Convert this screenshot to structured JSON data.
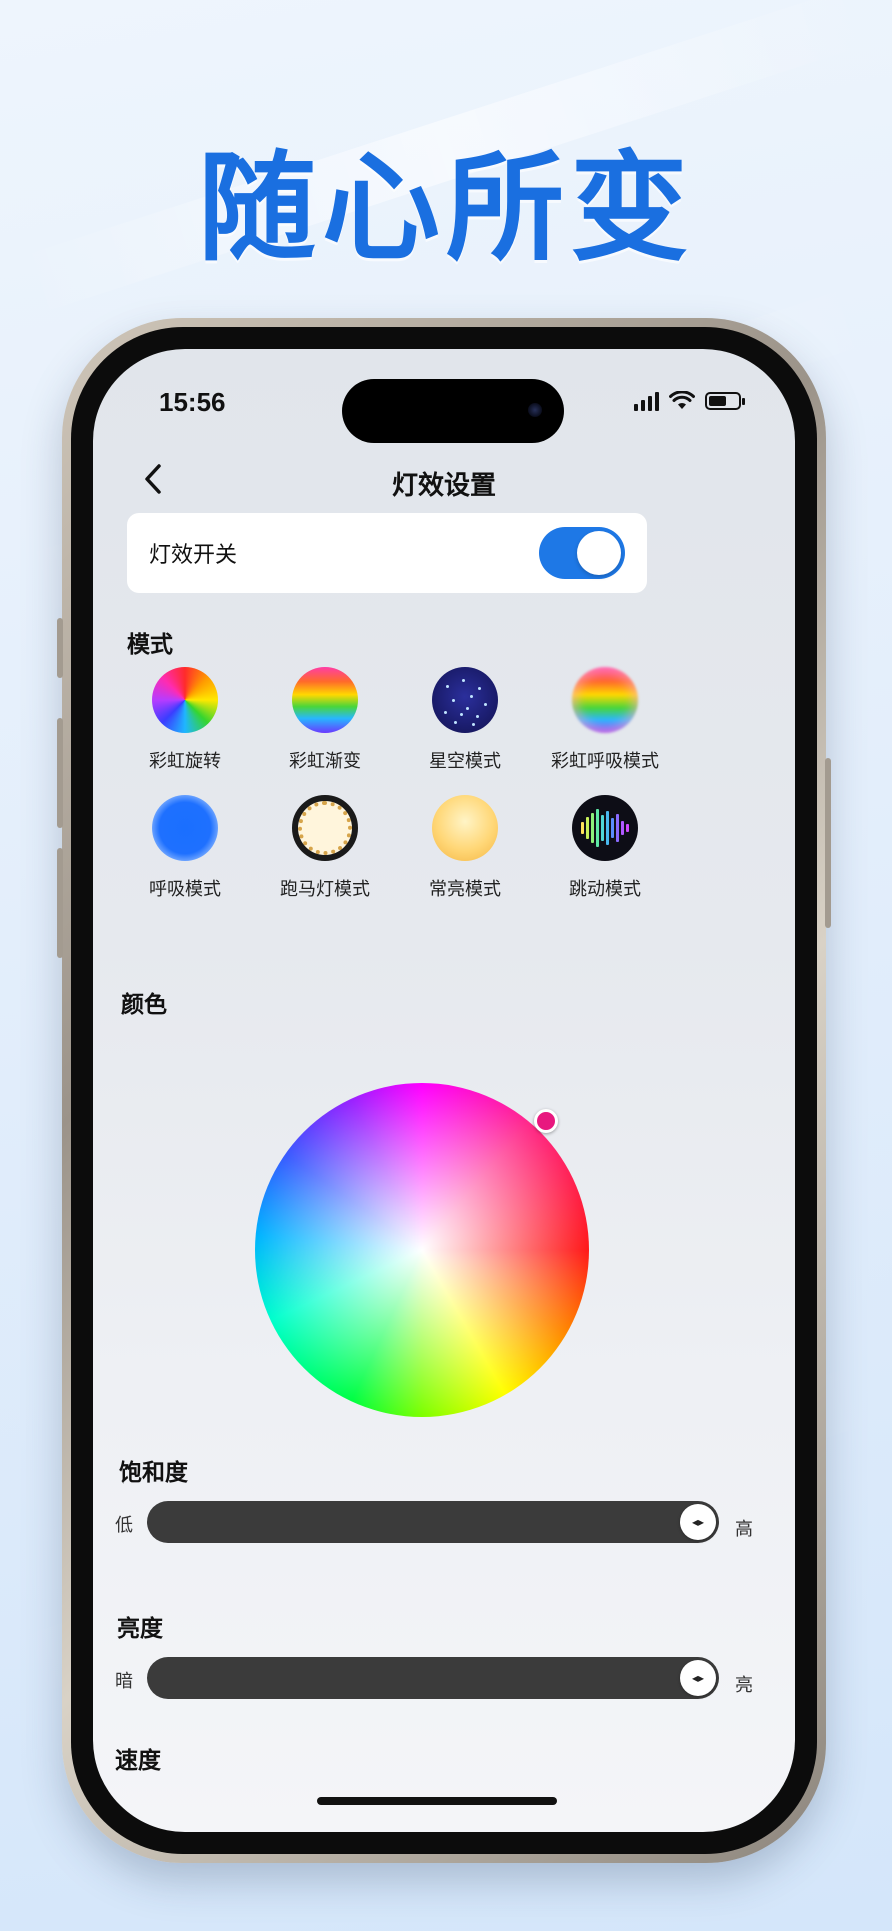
{
  "headline": "随心所变",
  "status_bar": {
    "time": "15:56"
  },
  "nav": {
    "title": "灯效设置"
  },
  "light_switch": {
    "label": "灯效开关",
    "on": true
  },
  "mode_section": {
    "title": "模式",
    "modes": [
      {
        "label": "彩虹旋转",
        "icon": "rainbow-rotate-icon"
      },
      {
        "label": "彩虹渐变",
        "icon": "rainbow-gradient-icon"
      },
      {
        "label": "星空模式",
        "icon": "starry-sky-icon"
      },
      {
        "label": "彩虹呼吸模式",
        "icon": "rainbow-breathing-icon"
      },
      {
        "label": "呼吸模式",
        "icon": "breathing-icon"
      },
      {
        "label": "跑马灯模式",
        "icon": "marquee-icon"
      },
      {
        "label": "常亮模式",
        "icon": "steady-light-icon"
      },
      {
        "label": "跳动模式",
        "icon": "sound-jump-icon"
      }
    ]
  },
  "color_section": {
    "title": "颜色",
    "selected_color": "#e8187f"
  },
  "saturation": {
    "title": "饱和度",
    "min_label": "低",
    "max_label": "高",
    "value_percent": 100
  },
  "brightness": {
    "title": "亮度",
    "min_label": "暗",
    "max_label": "亮",
    "value_percent": 100
  },
  "speed": {
    "title": "速度"
  },
  "colors": {
    "accent": "#1e78e6",
    "headline": "#1a6fe0",
    "track": "#3b3b3b"
  }
}
